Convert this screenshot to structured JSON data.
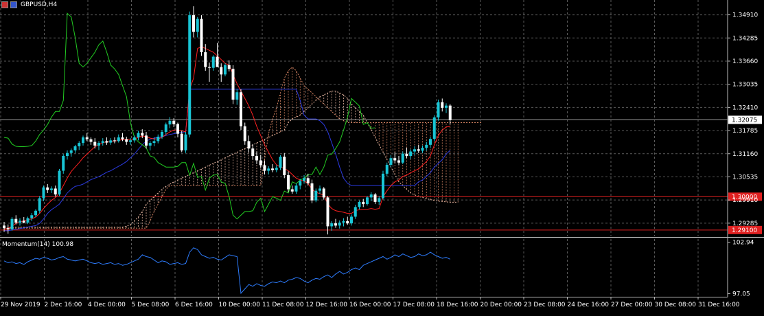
{
  "symbol": "GBPUSD,H4",
  "indicator_label": "Momentum(14) 100.98",
  "colors": {
    "background": "#000000",
    "grid": "#5a5a5a",
    "bull_candle": "#19c6d6",
    "bear_candle": "#ffffff",
    "tenkan": "#ff2020",
    "kijun": "#2b3ae0",
    "chikou": "#22cc22",
    "senkou_a": "#e4b4a0",
    "senkou_b": "#d08060",
    "momentum": "#2e7dff",
    "level_line": "#e02020",
    "bid_line": "#a0a0a0"
  },
  "chart_data": {
    "type": "candlestick",
    "price_axis_ticks": [
      "1.34910",
      "1.34285",
      "1.33660",
      "1.33035",
      "1.32410",
      "1.31785",
      "1.31160",
      "1.30535",
      "1.29910",
      "1.29285"
    ],
    "price_range": [
      1.2893,
      1.3531
    ],
    "current_price": "1.32075",
    "horizontal_levels": [
      {
        "label": "1.30000",
        "price": 1.3
      },
      {
        "label": "1.29100",
        "price": 1.291
      }
    ],
    "time_labels": [
      "29 Nov 2019",
      "2 Dec 16:00",
      "4 Dec 00:00",
      "5 Dec 08:00",
      "6 Dec 16:00",
      "10 Dec 00:00",
      "11 Dec 08:00",
      "12 Dec 16:00",
      "16 Dec 00:00",
      "17 Dec 08:00",
      "18 Dec 16:00",
      "20 Dec 00:00",
      "23 Dec 08:00",
      "24 Dec 16:00",
      "27 Dec 00:00",
      "30 Dec 08:00",
      "31 Dec 16:00"
    ],
    "momentum_axis_ticks": [
      "102.94",
      "97.05"
    ],
    "momentum_range": [
      96.7,
      103.3
    ],
    "momentum_last": 100.98,
    "candles": [
      [
        1.2922,
        1.2932,
        1.2905,
        1.2915
      ],
      [
        1.2915,
        1.2925,
        1.29,
        1.2912
      ],
      [
        1.2912,
        1.2945,
        1.2908,
        1.294
      ],
      [
        1.294,
        1.295,
        1.2925,
        1.293
      ],
      [
        1.293,
        1.2942,
        1.2922,
        1.2935
      ],
      [
        1.2935,
        1.2945,
        1.2928,
        1.293
      ],
      [
        1.293,
        1.2946,
        1.2926,
        1.2942
      ],
      [
        1.2942,
        1.2956,
        1.2934,
        1.295
      ],
      [
        1.295,
        1.2966,
        1.2945,
        1.2962
      ],
      [
        1.2962,
        1.3002,
        1.2955,
        1.2996
      ],
      [
        1.2996,
        1.303,
        1.2988,
        1.3025
      ],
      [
        1.3025,
        1.3034,
        1.301,
        1.3018
      ],
      [
        1.3018,
        1.3028,
        1.301,
        1.3022
      ],
      [
        1.3022,
        1.303,
        1.3,
        1.3006
      ],
      [
        1.3006,
        1.3075,
        1.3002,
        1.307
      ],
      [
        1.307,
        1.3115,
        1.3062,
        1.311
      ],
      [
        1.311,
        1.3125,
        1.31,
        1.3118
      ],
      [
        1.3118,
        1.313,
        1.3108,
        1.3125
      ],
      [
        1.3125,
        1.314,
        1.3118,
        1.3136
      ],
      [
        1.3136,
        1.315,
        1.3126,
        1.3145
      ],
      [
        1.3145,
        1.3165,
        1.3138,
        1.316
      ],
      [
        1.316,
        1.3172,
        1.315,
        1.3155
      ],
      [
        1.3155,
        1.316,
        1.314,
        1.3148
      ],
      [
        1.3148,
        1.3158,
        1.313,
        1.3138
      ],
      [
        1.3138,
        1.315,
        1.3126,
        1.3145
      ],
      [
        1.3145,
        1.3158,
        1.3138,
        1.315
      ],
      [
        1.315,
        1.316,
        1.314,
        1.3146
      ],
      [
        1.3146,
        1.3158,
        1.314,
        1.3152
      ],
      [
        1.3152,
        1.316,
        1.3144,
        1.315
      ],
      [
        1.315,
        1.3168,
        1.3146,
        1.316
      ],
      [
        1.316,
        1.3172,
        1.315,
        1.3155
      ],
      [
        1.3155,
        1.3162,
        1.314,
        1.3148
      ],
      [
        1.3148,
        1.3158,
        1.314,
        1.3152
      ],
      [
        1.3152,
        1.3165,
        1.3146,
        1.316
      ],
      [
        1.316,
        1.3178,
        1.3152,
        1.3172
      ],
      [
        1.3172,
        1.3182,
        1.3158,
        1.3165
      ],
      [
        1.3165,
        1.3175,
        1.313,
        1.3138
      ],
      [
        1.3138,
        1.315,
        1.3125,
        1.3145
      ],
      [
        1.3145,
        1.316,
        1.3136,
        1.315
      ],
      [
        1.315,
        1.3168,
        1.3144,
        1.3162
      ],
      [
        1.3162,
        1.318,
        1.3156,
        1.3175
      ],
      [
        1.3175,
        1.32,
        1.3168,
        1.3195
      ],
      [
        1.3195,
        1.3215,
        1.3185,
        1.3205
      ],
      [
        1.3205,
        1.3212,
        1.3188,
        1.3196
      ],
      [
        1.3196,
        1.32,
        1.316,
        1.317
      ],
      [
        1.317,
        1.3178,
        1.312,
        1.3125
      ],
      [
        1.3125,
        1.3175,
        1.3118,
        1.3168
      ],
      [
        1.3168,
        1.35,
        1.316,
        1.349
      ],
      [
        1.349,
        1.3514,
        1.343,
        1.3445
      ],
      [
        1.3445,
        1.3485,
        1.343,
        1.348
      ],
      [
        1.348,
        1.349,
        1.338,
        1.339
      ],
      [
        1.339,
        1.3412,
        1.334,
        1.335
      ],
      [
        1.335,
        1.3362,
        1.331,
        1.3348
      ],
      [
        1.3348,
        1.3382,
        1.334,
        1.3378
      ],
      [
        1.3378,
        1.3415,
        1.3365,
        1.335
      ],
      [
        1.335,
        1.336,
        1.331,
        1.333
      ],
      [
        1.333,
        1.336,
        1.3325,
        1.3355
      ],
      [
        1.3355,
        1.3368,
        1.3338,
        1.3345
      ],
      [
        1.3345,
        1.3355,
        1.325,
        1.3262
      ],
      [
        1.3262,
        1.329,
        1.3248,
        1.3282
      ],
      [
        1.3282,
        1.329,
        1.318,
        1.319
      ],
      [
        1.319,
        1.32,
        1.314,
        1.315
      ],
      [
        1.315,
        1.3165,
        1.312,
        1.313
      ],
      [
        1.313,
        1.3142,
        1.31,
        1.311
      ],
      [
        1.311,
        1.3122,
        1.3088,
        1.3098
      ],
      [
        1.3098,
        1.3112,
        1.3078,
        1.3085
      ],
      [
        1.3085,
        1.3098,
        1.306,
        1.307
      ],
      [
        1.307,
        1.3082,
        1.306,
        1.3076
      ],
      [
        1.3076,
        1.3088,
        1.3066,
        1.3072
      ],
      [
        1.3072,
        1.3085,
        1.3066,
        1.3078
      ],
      [
        1.3078,
        1.3112,
        1.3072,
        1.3108
      ],
      [
        1.3108,
        1.3118,
        1.305,
        1.3058
      ],
      [
        1.3058,
        1.3068,
        1.3012,
        1.302
      ],
      [
        1.302,
        1.303,
        1.3008,
        1.3014
      ],
      [
        1.3014,
        1.3036,
        1.3008,
        1.303
      ],
      [
        1.303,
        1.3048,
        1.302,
        1.3042
      ],
      [
        1.3042,
        1.3058,
        1.3035,
        1.305
      ],
      [
        1.305,
        1.3062,
        1.303,
        1.3036
      ],
      [
        1.3036,
        1.3046,
        1.2982,
        1.299
      ],
      [
        1.299,
        1.3022,
        1.2985,
        1.3016
      ],
      [
        1.3016,
        1.303,
        1.3008,
        1.3022
      ],
      [
        1.3022,
        1.3026,
        1.2992,
        1.2998
      ],
      [
        1.2998,
        1.3002,
        1.2898,
        1.292
      ],
      [
        1.292,
        1.2934,
        1.2908,
        1.2928
      ],
      [
        1.2928,
        1.294,
        1.2916,
        1.2922
      ],
      [
        1.2922,
        1.2936,
        1.2914,
        1.293
      ],
      [
        1.293,
        1.2942,
        1.292,
        1.2934
      ],
      [
        1.2934,
        1.2946,
        1.2924,
        1.2928
      ],
      [
        1.2928,
        1.2952,
        1.2922,
        1.2946
      ],
      [
        1.2946,
        1.2978,
        1.294,
        1.2972
      ],
      [
        1.2972,
        1.299,
        1.2966,
        1.2986
      ],
      [
        1.2986,
        1.2994,
        1.2972,
        1.298
      ],
      [
        1.298,
        1.3002,
        1.2976,
        1.2998
      ],
      [
        1.2998,
        1.3012,
        1.2988,
        1.3006
      ],
      [
        1.3006,
        1.301,
        1.298,
        1.2986
      ],
      [
        1.2986,
        1.3002,
        1.2978,
        1.2996
      ],
      [
        1.2996,
        1.307,
        1.2992,
        1.3062
      ],
      [
        1.3062,
        1.3092,
        1.3055,
        1.3086
      ],
      [
        1.3086,
        1.3112,
        1.308,
        1.3104
      ],
      [
        1.3104,
        1.312,
        1.309,
        1.3098
      ],
      [
        1.3098,
        1.311,
        1.3085,
        1.3092
      ],
      [
        1.3092,
        1.3122,
        1.3088,
        1.3116
      ],
      [
        1.3116,
        1.3132,
        1.3104,
        1.311
      ],
      [
        1.311,
        1.3128,
        1.3102,
        1.3122
      ],
      [
        1.3122,
        1.3136,
        1.3112,
        1.3128
      ],
      [
        1.3128,
        1.314,
        1.3118,
        1.3124
      ],
      [
        1.3124,
        1.3138,
        1.3118,
        1.3132
      ],
      [
        1.3132,
        1.3148,
        1.3124,
        1.314
      ],
      [
        1.314,
        1.3162,
        1.3132,
        1.3156
      ],
      [
        1.3156,
        1.322,
        1.315,
        1.3214
      ],
      [
        1.3214,
        1.3262,
        1.3205,
        1.3255
      ],
      [
        1.3255,
        1.3265,
        1.323,
        1.324
      ],
      [
        1.324,
        1.3252,
        1.3226,
        1.3246
      ],
      [
        1.3246,
        1.325,
        1.3195,
        1.3207
      ]
    ],
    "tenkan": [
      1.2912,
      1.2915,
      1.292,
      1.2928,
      1.2932,
      1.2935,
      1.2938,
      1.294,
      1.2945,
      1.2955,
      1.2968,
      1.298,
      1.299,
      1.2998,
      1.301,
      1.303,
      1.305,
      1.3068,
      1.308,
      1.3092,
      1.3105,
      1.3115,
      1.3125,
      1.3135,
      1.314,
      1.3146,
      1.3148,
      1.315,
      1.315,
      1.3152,
      1.3154,
      1.3155,
      1.3155,
      1.3156,
      1.316,
      1.3164,
      1.3162,
      1.3158,
      1.3156,
      1.3156,
      1.316,
      1.3168,
      1.3175,
      1.318,
      1.318,
      1.3178,
      1.3175,
      1.329,
      1.332,
      1.34,
      1.3405,
      1.34,
      1.3395,
      1.339,
      1.338,
      1.337,
      1.336,
      1.3355,
      1.333,
      1.3305,
      1.3285,
      1.3265,
      1.3245,
      1.322,
      1.319,
      1.3165,
      1.314,
      1.312,
      1.31,
      1.3086,
      1.308,
      1.3076,
      1.307,
      1.306,
      1.305,
      1.3045,
      1.3042,
      1.3036,
      1.302,
      1.3012,
      1.3008,
      1.3004,
      1.298,
      1.2968,
      1.2962,
      1.296,
      1.2958,
      1.2955,
      1.2955,
      1.2962,
      1.2965,
      1.2966,
      1.2966,
      1.2968,
      1.2966,
      1.2968,
      1.3,
      1.3016,
      1.303,
      1.304,
      1.3045,
      1.3055,
      1.3058,
      1.3065,
      1.307,
      1.3075,
      1.3085,
      1.3095,
      1.311,
      1.314,
      1.3165,
      1.318,
      1.3188,
      1.319
    ],
    "kijun": [
      1.2908,
      1.2908,
      1.291,
      1.2912,
      1.2914,
      1.2916,
      1.2918,
      1.292,
      1.2922,
      1.2928,
      1.294,
      1.2955,
      1.2965,
      1.2972,
      1.298,
      1.2995,
      1.301,
      1.302,
      1.3028,
      1.303,
      1.3034,
      1.304,
      1.3046,
      1.305,
      1.3054,
      1.306,
      1.3066,
      1.307,
      1.3076,
      1.3082,
      1.3088,
      1.3095,
      1.3105,
      1.3115,
      1.3128,
      1.314,
      1.315,
      1.3155,
      1.3158,
      1.316,
      1.3162,
      1.3165,
      1.3168,
      1.317,
      1.3172,
      1.3174,
      1.3175,
      1.329,
      1.329,
      1.329,
      1.329,
      1.329,
      1.329,
      1.329,
      1.329,
      1.329,
      1.329,
      1.329,
      1.329,
      1.329,
      1.329,
      1.329,
      1.329,
      1.329,
      1.329,
      1.329,
      1.329,
      1.329,
      1.329,
      1.329,
      1.329,
      1.329,
      1.329,
      1.329,
      1.329,
      1.326,
      1.322,
      1.321,
      1.321,
      1.321,
      1.3205,
      1.3195,
      1.3175,
      1.3145,
      1.3115,
      1.308,
      1.305,
      1.3036,
      1.303,
      1.303,
      1.303,
      1.303,
      1.303,
      1.303,
      1.303,
      1.303,
      1.303,
      1.303,
      1.303,
      1.303,
      1.303,
      1.303,
      1.303,
      1.303,
      1.303,
      1.304,
      1.3045,
      1.3055,
      1.3065,
      1.308,
      1.309,
      1.31,
      1.3115,
      1.3125
    ],
    "chikou": [
      1.316,
      1.3158,
      1.3142,
      1.3136,
      1.3135,
      1.3135,
      1.3136,
      1.3138,
      1.315,
      1.3168,
      1.318,
      1.3195,
      1.3215,
      1.323,
      1.323,
      1.326,
      1.3495,
      1.3485,
      1.343,
      1.336,
      1.335,
      1.336,
      1.3375,
      1.339,
      1.341,
      1.342,
      1.339,
      1.3355,
      1.3345,
      1.333,
      1.33,
      1.327,
      1.32,
      1.316,
      1.3148,
      1.314,
      1.3132,
      1.311,
      1.3106,
      1.3092,
      1.3086,
      1.308,
      1.308,
      1.308,
      1.3082,
      1.3092,
      1.3092,
      1.3058,
      1.309,
      1.3052,
      1.3055,
      1.3018,
      1.305,
      1.3058,
      1.306,
      1.304,
      1.3036,
      1.3,
      1.295,
      1.294,
      1.295,
      1.296,
      1.296,
      1.2962,
      1.2985,
      1.2996,
      1.296,
      1.298,
      1.3,
      1.2996,
      1.299,
      1.3015,
      1.301,
      1.304,
      1.3035,
      1.3045,
      1.305,
      1.306,
      1.306,
      1.308,
      1.306,
      1.308,
      1.3112,
      1.3115,
      1.313,
      1.3148,
      1.318,
      1.3215,
      1.3265,
      1.3255,
      1.3245,
      1.3195,
      1.32,
      1.3185,
      1.3186
    ],
    "senkou_a": [
      1.2915,
      1.2915,
      1.2916,
      1.2918,
      1.2918,
      1.2918,
      1.2918,
      1.2918,
      1.2918,
      1.2918,
      1.2918,
      1.2918,
      1.2918,
      1.2918,
      1.2918,
      1.2918,
      1.2918,
      1.2918,
      1.2918,
      1.2918,
      1.2918,
      1.2918,
      1.2918,
      1.2918,
      1.2918,
      1.2918,
      1.2918,
      1.2918,
      1.2918,
      1.2918,
      1.2918,
      1.292,
      1.2925,
      1.2935,
      1.2945,
      1.296,
      1.298,
      1.299,
      1.3,
      1.301,
      1.302,
      1.3028,
      1.3034,
      1.304,
      1.3045,
      1.305,
      1.3055,
      1.306,
      1.3065,
      1.307,
      1.3075,
      1.308,
      1.3085,
      1.309,
      1.3095,
      1.31,
      1.3105,
      1.311,
      1.3115,
      1.312,
      1.3125,
      1.313,
      1.3135,
      1.314,
      1.3145,
      1.315,
      1.3155,
      1.316,
      1.3165,
      1.317,
      1.3175,
      1.318,
      1.32,
      1.321,
      1.3215,
      1.322,
      1.323,
      1.324,
      1.325,
      1.326,
      1.327,
      1.3275,
      1.328,
      1.3285,
      1.3285,
      1.328,
      1.3275,
      1.3265,
      1.325,
      1.324,
      1.323,
      1.322,
      1.32,
      1.318,
      1.316,
      1.314,
      1.312,
      1.31,
      1.308,
      1.306,
      1.304,
      1.303,
      1.302,
      1.301,
      1.3005,
      1.3,
      1.2998,
      1.2995,
      1.2992,
      1.299,
      1.2988,
      1.2987,
      1.2986,
      1.2985,
      1.2985,
      1.2985
    ],
    "senkou_b": [
      1.2915,
      1.2915,
      1.2915,
      1.2915,
      1.2915,
      1.2915,
      1.2915,
      1.2915,
      1.2915,
      1.2915,
      1.2915,
      1.2915,
      1.2915,
      1.2915,
      1.2915,
      1.2915,
      1.2915,
      1.2915,
      1.2915,
      1.2915,
      1.2915,
      1.2915,
      1.2915,
      1.2915,
      1.2915,
      1.2915,
      1.2915,
      1.2915,
      1.2915,
      1.2915,
      1.2915,
      1.2915,
      1.2915,
      1.2915,
      1.2915,
      1.2915,
      1.2915,
      1.2935,
      1.296,
      1.298,
      1.3,
      1.302,
      1.303,
      1.303,
      1.303,
      1.303,
      1.303,
      1.303,
      1.303,
      1.303,
      1.303,
      1.303,
      1.303,
      1.303,
      1.303,
      1.303,
      1.303,
      1.303,
      1.303,
      1.303,
      1.303,
      1.303,
      1.303,
      1.303,
      1.303,
      1.303,
      1.31,
      1.317,
      1.321,
      1.324,
      1.328,
      1.332,
      1.334,
      1.335,
      1.334,
      1.332,
      1.33,
      1.329,
      1.328,
      1.327,
      1.326,
      1.325,
      1.324,
      1.323,
      1.322,
      1.321,
      1.3205,
      1.32,
      1.32,
      1.32,
      1.32,
      1.32,
      1.32,
      1.32,
      1.32,
      1.32,
      1.32,
      1.32,
      1.32,
      1.32,
      1.32,
      1.32,
      1.32,
      1.32,
      1.32,
      1.32,
      1.32,
      1.32,
      1.32,
      1.32,
      1.32,
      1.32,
      1.32,
      1.32,
      1.32,
      1.32,
      1.32,
      1.32,
      1.32,
      1.32,
      1.32,
      1.32
    ],
    "momentum": [
      100.8,
      100.6,
      100.7,
      100.5,
      100.6,
      100.4,
      100.7,
      100.9,
      101.1,
      101.0,
      101.2,
      101.1,
      100.9,
      101.0,
      101.2,
      101.3,
      101.0,
      100.9,
      100.8,
      100.9,
      101.0,
      100.8,
      100.6,
      100.5,
      100.6,
      100.4,
      100.5,
      100.6,
      100.4,
      100.5,
      100.3,
      100.4,
      100.6,
      100.8,
      101.0,
      101.5,
      101.3,
      101.2,
      100.9,
      100.6,
      100.8,
      100.7,
      100.4,
      100.5,
      100.6,
      100.4,
      100.5,
      101.8,
      102.3,
      102.1,
      101.5,
      101.3,
      101.1,
      101.2,
      101.0,
      100.9,
      101.2,
      101.5,
      101.4,
      101.3,
      97.1,
      97.6,
      98.1,
      97.9,
      98.2,
      98.0,
      97.9,
      98.2,
      98.4,
      98.3,
      98.5,
      98.3,
      98.6,
      98.7,
      98.9,
      98.8,
      98.5,
      98.3,
      98.6,
      98.8,
      98.7,
      99.0,
      99.2,
      98.9,
      99.3,
      99.6,
      99.3,
      99.5,
      99.8,
      100.0,
      99.8,
      100.3,
      100.5,
      100.7,
      100.9,
      101.1,
      101.3,
      101.0,
      101.2,
      101.5,
      101.3,
      101.6,
      101.4,
      101.2,
      101.3,
      101.6,
      101.4,
      101.5,
      101.8,
      101.5,
      101.3,
      101.1,
      101.2,
      101.0
    ]
  }
}
